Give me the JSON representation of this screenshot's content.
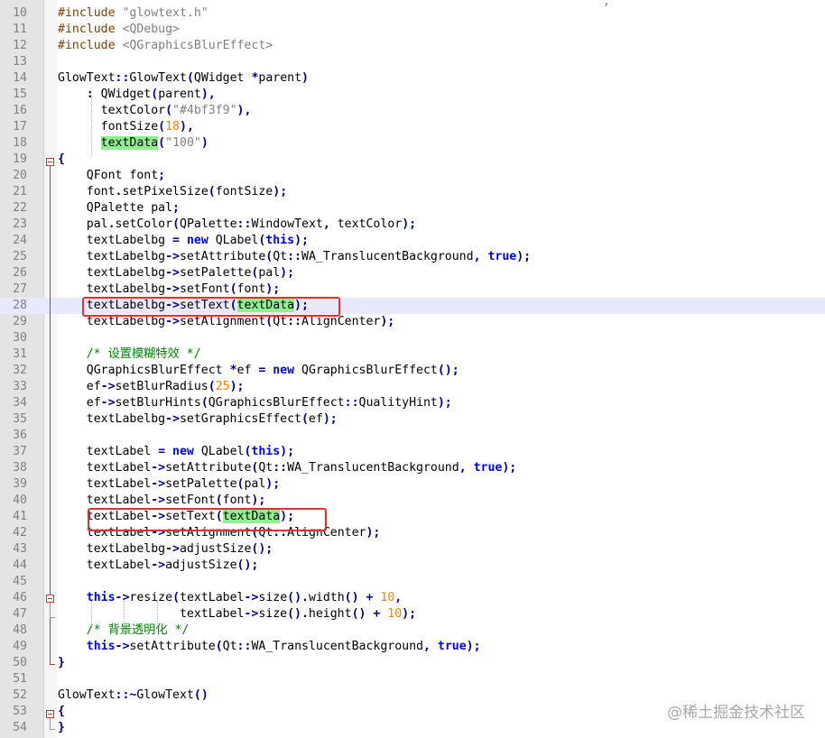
{
  "editor": {
    "partial_top_char": ",",
    "lines": [
      {
        "n": "10",
        "tokens": [
          {
            "t": "pp",
            "v": "#include "
          },
          {
            "t": "str",
            "v": "\"glowtext.h\""
          }
        ]
      },
      {
        "n": "11",
        "tokens": [
          {
            "t": "pp",
            "v": "#include "
          },
          {
            "t": "str",
            "v": "<QDebug>"
          }
        ]
      },
      {
        "n": "12",
        "tokens": [
          {
            "t": "pp",
            "v": "#include "
          },
          {
            "t": "str",
            "v": "<QGraphicsBlurEffect>"
          }
        ]
      },
      {
        "n": "13",
        "tokens": []
      },
      {
        "n": "14",
        "tokens": [
          {
            "t": "",
            "v": "GlowText"
          },
          {
            "t": "op",
            "v": "::"
          },
          {
            "t": "",
            "v": "GlowText"
          },
          {
            "t": "op",
            "v": "("
          },
          {
            "t": "",
            "v": "QWidget "
          },
          {
            "t": "op",
            "v": "*"
          },
          {
            "t": "",
            "v": "parent"
          },
          {
            "t": "op",
            "v": ")"
          }
        ]
      },
      {
        "n": "15",
        "tokens": [
          {
            "t": "",
            "v": "    "
          },
          {
            "t": "op",
            "v": ": "
          },
          {
            "t": "",
            "v": "QWidget"
          },
          {
            "t": "op",
            "v": "("
          },
          {
            "t": "",
            "v": "parent"
          },
          {
            "t": "op",
            "v": "),"
          }
        ]
      },
      {
        "n": "16",
        "tokens": [
          {
            "t": "",
            "v": "      textColor"
          },
          {
            "t": "op",
            "v": "("
          },
          {
            "t": "str",
            "v": "\"#4bf3f9\""
          },
          {
            "t": "op",
            "v": "),"
          }
        ]
      },
      {
        "n": "17",
        "tokens": [
          {
            "t": "",
            "v": "      fontSize"
          },
          {
            "t": "op",
            "v": "("
          },
          {
            "t": "num",
            "v": "18"
          },
          {
            "t": "op",
            "v": "),"
          }
        ]
      },
      {
        "n": "18",
        "tokens": [
          {
            "t": "",
            "v": "      "
          },
          {
            "t": "hl",
            "v": "textData"
          },
          {
            "t": "op",
            "v": "("
          },
          {
            "t": "str",
            "v": "\"100\""
          },
          {
            "t": "op",
            "v": ")"
          }
        ]
      },
      {
        "n": "19",
        "tokens": [
          {
            "t": "op",
            "v": "{"
          }
        ]
      },
      {
        "n": "20",
        "tokens": [
          {
            "t": "",
            "v": "    QFont font"
          },
          {
            "t": "op",
            "v": ";"
          }
        ]
      },
      {
        "n": "21",
        "tokens": [
          {
            "t": "",
            "v": "    font"
          },
          {
            "t": "op",
            "v": "."
          },
          {
            "t": "",
            "v": "setPixelSize"
          },
          {
            "t": "op",
            "v": "("
          },
          {
            "t": "",
            "v": "fontSize"
          },
          {
            "t": "op",
            "v": ");"
          }
        ]
      },
      {
        "n": "22",
        "tokens": [
          {
            "t": "",
            "v": "    QPalette pal"
          },
          {
            "t": "op",
            "v": ";"
          }
        ]
      },
      {
        "n": "23",
        "tokens": [
          {
            "t": "",
            "v": "    pal"
          },
          {
            "t": "op",
            "v": "."
          },
          {
            "t": "",
            "v": "setColor"
          },
          {
            "t": "op",
            "v": "("
          },
          {
            "t": "",
            "v": "QPalette"
          },
          {
            "t": "op",
            "v": "::"
          },
          {
            "t": "",
            "v": "WindowText"
          },
          {
            "t": "op",
            "v": ", "
          },
          {
            "t": "",
            "v": "textColor"
          },
          {
            "t": "op",
            "v": ");"
          }
        ]
      },
      {
        "n": "24",
        "tokens": [
          {
            "t": "",
            "v": "    textLabelbg "
          },
          {
            "t": "op",
            "v": "= "
          },
          {
            "t": "kw",
            "v": "new "
          },
          {
            "t": "",
            "v": "QLabel"
          },
          {
            "t": "op",
            "v": "("
          },
          {
            "t": "kw",
            "v": "this"
          },
          {
            "t": "op",
            "v": ");"
          }
        ]
      },
      {
        "n": "25",
        "tokens": [
          {
            "t": "",
            "v": "    textLabelbg"
          },
          {
            "t": "op",
            "v": "->"
          },
          {
            "t": "",
            "v": "setAttribute"
          },
          {
            "t": "op",
            "v": "("
          },
          {
            "t": "",
            "v": "Qt"
          },
          {
            "t": "op",
            "v": "::"
          },
          {
            "t": "",
            "v": "WA_TranslucentBackground"
          },
          {
            "t": "op",
            "v": ", "
          },
          {
            "t": "kw",
            "v": "true"
          },
          {
            "t": "op",
            "v": ");"
          }
        ]
      },
      {
        "n": "26",
        "tokens": [
          {
            "t": "",
            "v": "    textLabelbg"
          },
          {
            "t": "op",
            "v": "->"
          },
          {
            "t": "",
            "v": "setPalette"
          },
          {
            "t": "op",
            "v": "("
          },
          {
            "t": "",
            "v": "pal"
          },
          {
            "t": "op",
            "v": ");"
          }
        ]
      },
      {
        "n": "27",
        "tokens": [
          {
            "t": "",
            "v": "    textLabelbg"
          },
          {
            "t": "op",
            "v": "->"
          },
          {
            "t": "",
            "v": "setFont"
          },
          {
            "t": "op",
            "v": "("
          },
          {
            "t": "",
            "v": "font"
          },
          {
            "t": "op",
            "v": ");"
          }
        ]
      },
      {
        "n": "28",
        "current": true,
        "tokens": [
          {
            "t": "",
            "v": "    textLabelbg"
          },
          {
            "t": "op",
            "v": "->"
          },
          {
            "t": "",
            "v": "setText"
          },
          {
            "t": "op",
            "v": "("
          },
          {
            "t": "hl",
            "v": "textData"
          },
          {
            "t": "op",
            "v": ");"
          }
        ]
      },
      {
        "n": "29",
        "tokens": [
          {
            "t": "",
            "v": "    textLabelbg"
          },
          {
            "t": "op",
            "v": "->"
          },
          {
            "t": "",
            "v": "setAlignment"
          },
          {
            "t": "op",
            "v": "("
          },
          {
            "t": "",
            "v": "Qt"
          },
          {
            "t": "op",
            "v": "::"
          },
          {
            "t": "",
            "v": "AlignCenter"
          },
          {
            "t": "op",
            "v": ");"
          }
        ]
      },
      {
        "n": "30",
        "tokens": []
      },
      {
        "n": "31",
        "tokens": [
          {
            "t": "cmt",
            "v": "    /* 设置模糊特效 */"
          }
        ]
      },
      {
        "n": "32",
        "tokens": [
          {
            "t": "",
            "v": "    QGraphicsBlurEffect "
          },
          {
            "t": "op",
            "v": "*"
          },
          {
            "t": "",
            "v": "ef "
          },
          {
            "t": "op",
            "v": "= "
          },
          {
            "t": "kw",
            "v": "new "
          },
          {
            "t": "",
            "v": "QGraphicsBlurEffect"
          },
          {
            "t": "op",
            "v": "();"
          }
        ]
      },
      {
        "n": "33",
        "tokens": [
          {
            "t": "",
            "v": "    ef"
          },
          {
            "t": "op",
            "v": "->"
          },
          {
            "t": "",
            "v": "setBlurRadius"
          },
          {
            "t": "op",
            "v": "("
          },
          {
            "t": "num",
            "v": "25"
          },
          {
            "t": "op",
            "v": ");"
          }
        ]
      },
      {
        "n": "34",
        "tokens": [
          {
            "t": "",
            "v": "    ef"
          },
          {
            "t": "op",
            "v": "->"
          },
          {
            "t": "",
            "v": "setBlurHints"
          },
          {
            "t": "op",
            "v": "("
          },
          {
            "t": "",
            "v": "QGraphicsBlurEffect"
          },
          {
            "t": "op",
            "v": "::"
          },
          {
            "t": "",
            "v": "QualityHint"
          },
          {
            "t": "op",
            "v": ");"
          }
        ]
      },
      {
        "n": "35",
        "tokens": [
          {
            "t": "",
            "v": "    textLabelbg"
          },
          {
            "t": "op",
            "v": "->"
          },
          {
            "t": "",
            "v": "setGraphicsEffect"
          },
          {
            "t": "op",
            "v": "("
          },
          {
            "t": "",
            "v": "ef"
          },
          {
            "t": "op",
            "v": ");"
          }
        ]
      },
      {
        "n": "36",
        "tokens": []
      },
      {
        "n": "37",
        "tokens": [
          {
            "t": "",
            "v": "    textLabel "
          },
          {
            "t": "op",
            "v": "= "
          },
          {
            "t": "kw",
            "v": "new "
          },
          {
            "t": "",
            "v": "QLabel"
          },
          {
            "t": "op",
            "v": "("
          },
          {
            "t": "kw",
            "v": "this"
          },
          {
            "t": "op",
            "v": ");"
          }
        ]
      },
      {
        "n": "38",
        "tokens": [
          {
            "t": "",
            "v": "    textLabel"
          },
          {
            "t": "op",
            "v": "->"
          },
          {
            "t": "",
            "v": "setAttribute"
          },
          {
            "t": "op",
            "v": "("
          },
          {
            "t": "",
            "v": "Qt"
          },
          {
            "t": "op",
            "v": "::"
          },
          {
            "t": "",
            "v": "WA_TranslucentBackground"
          },
          {
            "t": "op",
            "v": ", "
          },
          {
            "t": "kw",
            "v": "true"
          },
          {
            "t": "op",
            "v": ");"
          }
        ]
      },
      {
        "n": "39",
        "tokens": [
          {
            "t": "",
            "v": "    textLabel"
          },
          {
            "t": "op",
            "v": "->"
          },
          {
            "t": "",
            "v": "setPalette"
          },
          {
            "t": "op",
            "v": "("
          },
          {
            "t": "",
            "v": "pal"
          },
          {
            "t": "op",
            "v": ");"
          }
        ]
      },
      {
        "n": "40",
        "tokens": [
          {
            "t": "",
            "v": "    textLabel"
          },
          {
            "t": "op",
            "v": "->"
          },
          {
            "t": "",
            "v": "setFont"
          },
          {
            "t": "op",
            "v": "("
          },
          {
            "t": "",
            "v": "font"
          },
          {
            "t": "op",
            "v": ");"
          }
        ]
      },
      {
        "n": "41",
        "tokens": [
          {
            "t": "",
            "v": "    textLabel"
          },
          {
            "t": "op",
            "v": "->"
          },
          {
            "t": "",
            "v": "setText"
          },
          {
            "t": "op",
            "v": "("
          },
          {
            "t": "hl",
            "v": "textData"
          },
          {
            "t": "op",
            "v": ");"
          }
        ]
      },
      {
        "n": "42",
        "tokens": [
          {
            "t": "",
            "v": "    textLabel"
          },
          {
            "t": "op",
            "v": "->"
          },
          {
            "t": "",
            "v": "setAlignment"
          },
          {
            "t": "op",
            "v": "("
          },
          {
            "t": "",
            "v": "Qt"
          },
          {
            "t": "op",
            "v": "::"
          },
          {
            "t": "",
            "v": "AlignCenter"
          },
          {
            "t": "op",
            "v": ");"
          }
        ]
      },
      {
        "n": "43",
        "tokens": [
          {
            "t": "",
            "v": "    textLabelbg"
          },
          {
            "t": "op",
            "v": "->"
          },
          {
            "t": "",
            "v": "adjustSize"
          },
          {
            "t": "op",
            "v": "();"
          }
        ]
      },
      {
        "n": "44",
        "tokens": [
          {
            "t": "",
            "v": "    textLabel"
          },
          {
            "t": "op",
            "v": "->"
          },
          {
            "t": "",
            "v": "adjustSize"
          },
          {
            "t": "op",
            "v": "();"
          }
        ]
      },
      {
        "n": "45",
        "tokens": []
      },
      {
        "n": "46",
        "tokens": [
          {
            "t": "kw",
            "v": "    this"
          },
          {
            "t": "op",
            "v": "->"
          },
          {
            "t": "",
            "v": "resize"
          },
          {
            "t": "op",
            "v": "("
          },
          {
            "t": "",
            "v": "textLabel"
          },
          {
            "t": "op",
            "v": "->"
          },
          {
            "t": "",
            "v": "size"
          },
          {
            "t": "op",
            "v": "()."
          },
          {
            "t": "",
            "v": "width"
          },
          {
            "t": "op",
            "v": "() + "
          },
          {
            "t": "num",
            "v": "10"
          },
          {
            "t": "op",
            "v": ","
          }
        ]
      },
      {
        "n": "47",
        "tokens": [
          {
            "t": "",
            "v": "                 textLabel"
          },
          {
            "t": "op",
            "v": "->"
          },
          {
            "t": "",
            "v": "size"
          },
          {
            "t": "op",
            "v": "()."
          },
          {
            "t": "",
            "v": "height"
          },
          {
            "t": "op",
            "v": "() + "
          },
          {
            "t": "num",
            "v": "10"
          },
          {
            "t": "op",
            "v": ");"
          }
        ]
      },
      {
        "n": "48",
        "tokens": [
          {
            "t": "cmt",
            "v": "    /* 背景透明化 */"
          }
        ]
      },
      {
        "n": "49",
        "tokens": [
          {
            "t": "kw",
            "v": "    this"
          },
          {
            "t": "op",
            "v": "->"
          },
          {
            "t": "",
            "v": "setAttribute"
          },
          {
            "t": "op",
            "v": "("
          },
          {
            "t": "",
            "v": "Qt"
          },
          {
            "t": "op",
            "v": "::"
          },
          {
            "t": "",
            "v": "WA_TranslucentBackground"
          },
          {
            "t": "op",
            "v": ", "
          },
          {
            "t": "kw",
            "v": "true"
          },
          {
            "t": "op",
            "v": ");"
          }
        ]
      },
      {
        "n": "50",
        "tokens": [
          {
            "t": "op",
            "v": "}"
          }
        ]
      },
      {
        "n": "51",
        "tokens": []
      },
      {
        "n": "52",
        "tokens": [
          {
            "t": "",
            "v": "GlowText"
          },
          {
            "t": "op",
            "v": "::~"
          },
          {
            "t": "",
            "v": "GlowText"
          },
          {
            "t": "op",
            "v": "()"
          }
        ]
      },
      {
        "n": "53",
        "tokens": [
          {
            "t": "op",
            "v": "{"
          }
        ]
      },
      {
        "n": "54",
        "tokens": [
          {
            "t": "op",
            "v": "}"
          }
        ]
      }
    ]
  },
  "watermark": "@稀土掘金技术社区",
  "colors": {
    "keyword": "#0000ff",
    "string": "#808080",
    "number": "#ff8000",
    "comment": "#008000",
    "preprocessor": "#804000",
    "highlight": "#8ff08f",
    "current_line": "#e8e8ff",
    "callout": "#e03030"
  }
}
